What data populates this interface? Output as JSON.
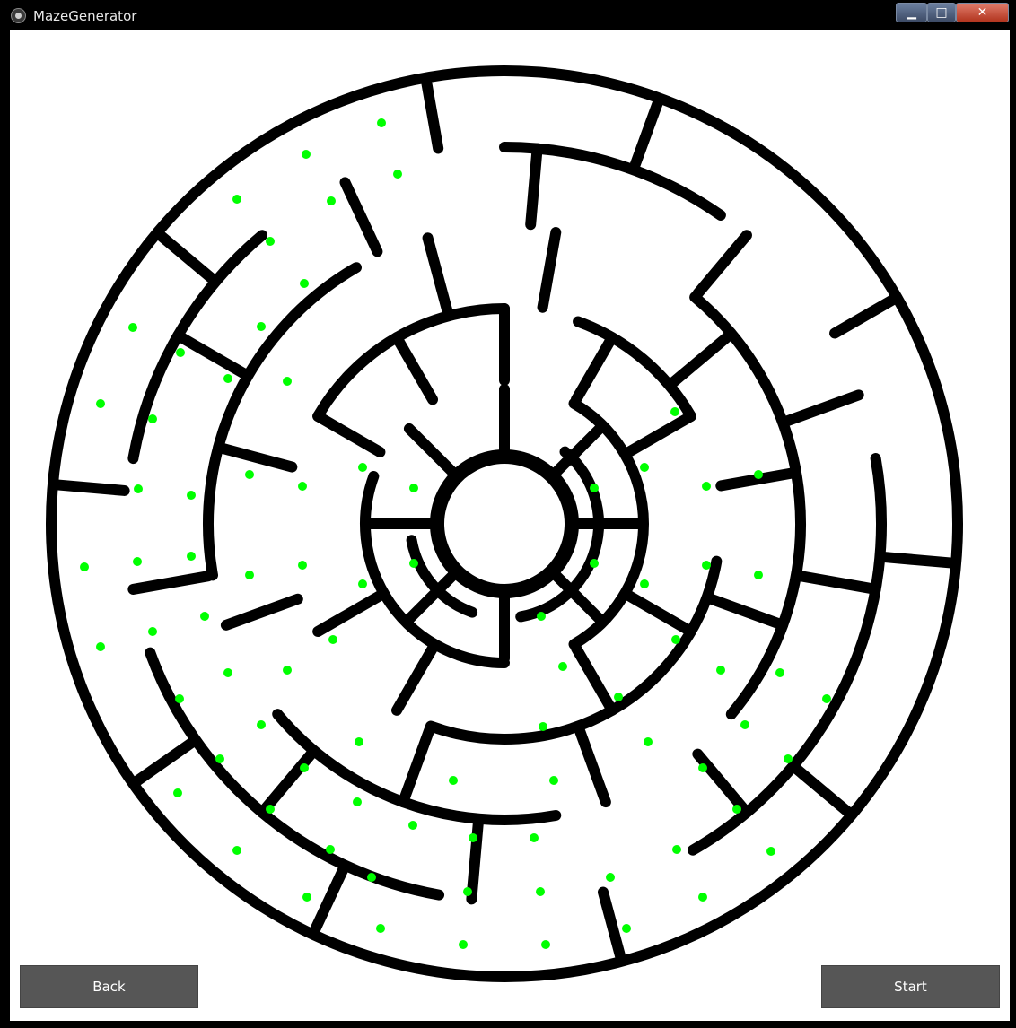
{
  "window": {
    "title": "MazeGenerator"
  },
  "titlebar_buttons": {
    "minimize_icon": "minimize-icon",
    "maximize_icon": "maximize-icon",
    "close_icon": "close-icon"
  },
  "buttons": {
    "back_label": "Back",
    "start_label": "Start"
  },
  "colors": {
    "wall": "#000000",
    "marker": "#00ff00",
    "background": "#ffffff",
    "button": "#565656"
  }
}
